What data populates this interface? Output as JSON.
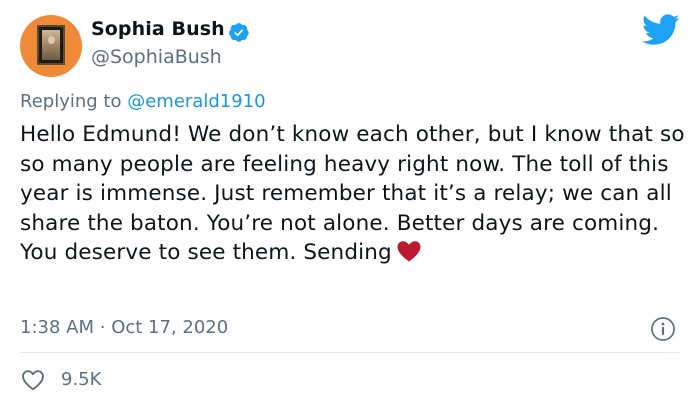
{
  "author": {
    "display_name": "Sophia Bush",
    "handle": "@SophiaBush",
    "verified": true
  },
  "reply": {
    "prefix": "Replying to",
    "mention": "@emerald1910"
  },
  "tweet": {
    "text": "Hello Edmund! We don’t know each other, but I know that so so many people are feeling heavy right now. The toll of this year is immense. Just remember that it’s a relay; we can all share the baton. You’re not alone. Better days are coming. You deserve to see them. Sending",
    "emoji": "red-heart"
  },
  "meta": {
    "time": "1:38 AM",
    "separator": "·",
    "date": "Oct 17, 2020"
  },
  "stats": {
    "likes": "9.5K"
  },
  "colors": {
    "brand": "#1da1f2",
    "secondary_text": "#5b7083",
    "mention": "#1b95e0",
    "heart": "#be1931",
    "avatar_bg": "#ef8a38"
  },
  "icons": [
    "verified-badge-icon",
    "twitter-bird-icon",
    "info-icon",
    "heart-outline-icon",
    "red-heart-emoji"
  ]
}
